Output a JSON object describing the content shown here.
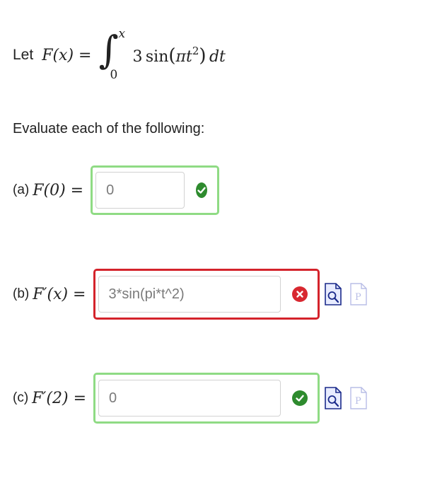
{
  "problem": {
    "let_label": "Let",
    "function_lhs": "F(x) =",
    "integral_upper": "x",
    "integral_lower": "0",
    "integrand_coef": "3",
    "integrand_func": "sin",
    "integrand_arg_pi": "π",
    "integrand_arg_var": "t",
    "integrand_arg_exp": "2",
    "differential": "dt"
  },
  "instruction": "Evaluate each of the following:",
  "parts": [
    {
      "label": "(a)",
      "expression": "F(0) =",
      "answer_value": "0",
      "status": "correct"
    },
    {
      "label": "(b)",
      "expression": "F′(x) =",
      "answer_value": "3*sin(pi*t^2)",
      "status": "incorrect"
    },
    {
      "label": "(c)",
      "expression": "F′(2) =",
      "answer_value": "0",
      "status": "correct"
    }
  ],
  "colors": {
    "correct_border": "#8fdb84",
    "correct_icon": "#2e8b2e",
    "incorrect_border": "#d4232b",
    "incorrect_icon": "#d82830",
    "preview_icon": "#1a2a8a",
    "pdf_icon_disabled": "#b8bde6"
  },
  "icons": {
    "correct": "check-circle-icon",
    "incorrect": "x-circle-icon",
    "preview": "document-preview-icon",
    "pdf": "document-p-icon"
  }
}
